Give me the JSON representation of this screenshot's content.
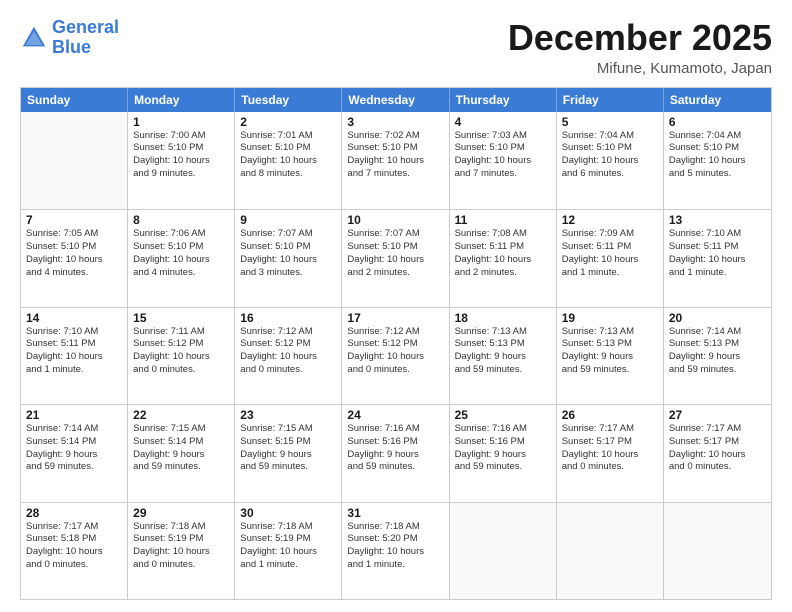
{
  "logo": {
    "line1": "General",
    "line2": "Blue"
  },
  "title": "December 2025",
  "location": "Mifune, Kumamoto, Japan",
  "header_days": [
    "Sunday",
    "Monday",
    "Tuesday",
    "Wednesday",
    "Thursday",
    "Friday",
    "Saturday"
  ],
  "weeks": [
    [
      {
        "day": "",
        "info": ""
      },
      {
        "day": "1",
        "info": "Sunrise: 7:00 AM\nSunset: 5:10 PM\nDaylight: 10 hours\nand 9 minutes."
      },
      {
        "day": "2",
        "info": "Sunrise: 7:01 AM\nSunset: 5:10 PM\nDaylight: 10 hours\nand 8 minutes."
      },
      {
        "day": "3",
        "info": "Sunrise: 7:02 AM\nSunset: 5:10 PM\nDaylight: 10 hours\nand 7 minutes."
      },
      {
        "day": "4",
        "info": "Sunrise: 7:03 AM\nSunset: 5:10 PM\nDaylight: 10 hours\nand 7 minutes."
      },
      {
        "day": "5",
        "info": "Sunrise: 7:04 AM\nSunset: 5:10 PM\nDaylight: 10 hours\nand 6 minutes."
      },
      {
        "day": "6",
        "info": "Sunrise: 7:04 AM\nSunset: 5:10 PM\nDaylight: 10 hours\nand 5 minutes."
      }
    ],
    [
      {
        "day": "7",
        "info": "Sunrise: 7:05 AM\nSunset: 5:10 PM\nDaylight: 10 hours\nand 4 minutes."
      },
      {
        "day": "8",
        "info": "Sunrise: 7:06 AM\nSunset: 5:10 PM\nDaylight: 10 hours\nand 4 minutes."
      },
      {
        "day": "9",
        "info": "Sunrise: 7:07 AM\nSunset: 5:10 PM\nDaylight: 10 hours\nand 3 minutes."
      },
      {
        "day": "10",
        "info": "Sunrise: 7:07 AM\nSunset: 5:10 PM\nDaylight: 10 hours\nand 2 minutes."
      },
      {
        "day": "11",
        "info": "Sunrise: 7:08 AM\nSunset: 5:11 PM\nDaylight: 10 hours\nand 2 minutes."
      },
      {
        "day": "12",
        "info": "Sunrise: 7:09 AM\nSunset: 5:11 PM\nDaylight: 10 hours\nand 1 minute."
      },
      {
        "day": "13",
        "info": "Sunrise: 7:10 AM\nSunset: 5:11 PM\nDaylight: 10 hours\nand 1 minute."
      }
    ],
    [
      {
        "day": "14",
        "info": "Sunrise: 7:10 AM\nSunset: 5:11 PM\nDaylight: 10 hours\nand 1 minute."
      },
      {
        "day": "15",
        "info": "Sunrise: 7:11 AM\nSunset: 5:12 PM\nDaylight: 10 hours\nand 0 minutes."
      },
      {
        "day": "16",
        "info": "Sunrise: 7:12 AM\nSunset: 5:12 PM\nDaylight: 10 hours\nand 0 minutes."
      },
      {
        "day": "17",
        "info": "Sunrise: 7:12 AM\nSunset: 5:12 PM\nDaylight: 10 hours\nand 0 minutes."
      },
      {
        "day": "18",
        "info": "Sunrise: 7:13 AM\nSunset: 5:13 PM\nDaylight: 9 hours\nand 59 minutes."
      },
      {
        "day": "19",
        "info": "Sunrise: 7:13 AM\nSunset: 5:13 PM\nDaylight: 9 hours\nand 59 minutes."
      },
      {
        "day": "20",
        "info": "Sunrise: 7:14 AM\nSunset: 5:13 PM\nDaylight: 9 hours\nand 59 minutes."
      }
    ],
    [
      {
        "day": "21",
        "info": "Sunrise: 7:14 AM\nSunset: 5:14 PM\nDaylight: 9 hours\nand 59 minutes."
      },
      {
        "day": "22",
        "info": "Sunrise: 7:15 AM\nSunset: 5:14 PM\nDaylight: 9 hours\nand 59 minutes."
      },
      {
        "day": "23",
        "info": "Sunrise: 7:15 AM\nSunset: 5:15 PM\nDaylight: 9 hours\nand 59 minutes."
      },
      {
        "day": "24",
        "info": "Sunrise: 7:16 AM\nSunset: 5:16 PM\nDaylight: 9 hours\nand 59 minutes."
      },
      {
        "day": "25",
        "info": "Sunrise: 7:16 AM\nSunset: 5:16 PM\nDaylight: 9 hours\nand 59 minutes."
      },
      {
        "day": "26",
        "info": "Sunrise: 7:17 AM\nSunset: 5:17 PM\nDaylight: 10 hours\nand 0 minutes."
      },
      {
        "day": "27",
        "info": "Sunrise: 7:17 AM\nSunset: 5:17 PM\nDaylight: 10 hours\nand 0 minutes."
      }
    ],
    [
      {
        "day": "28",
        "info": "Sunrise: 7:17 AM\nSunset: 5:18 PM\nDaylight: 10 hours\nand 0 minutes."
      },
      {
        "day": "29",
        "info": "Sunrise: 7:18 AM\nSunset: 5:19 PM\nDaylight: 10 hours\nand 0 minutes."
      },
      {
        "day": "30",
        "info": "Sunrise: 7:18 AM\nSunset: 5:19 PM\nDaylight: 10 hours\nand 1 minute."
      },
      {
        "day": "31",
        "info": "Sunrise: 7:18 AM\nSunset: 5:20 PM\nDaylight: 10 hours\nand 1 minute."
      },
      {
        "day": "",
        "info": ""
      },
      {
        "day": "",
        "info": ""
      },
      {
        "day": "",
        "info": ""
      }
    ]
  ]
}
